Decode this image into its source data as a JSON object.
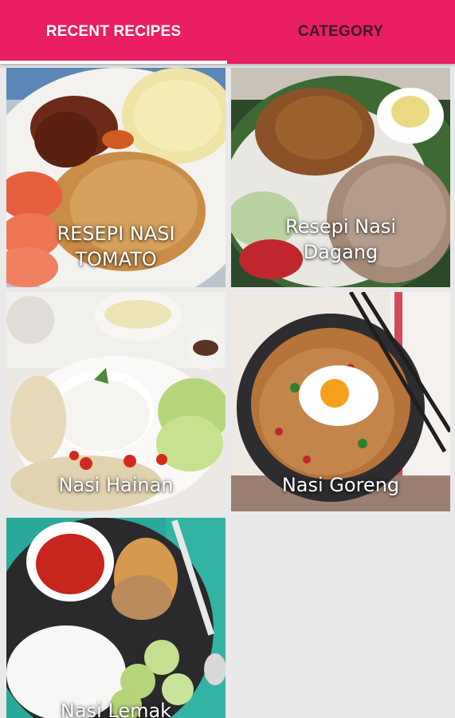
{
  "tabs": {
    "recent": "RECENT RECIPES",
    "category": "CATEGORY"
  },
  "colors": {
    "accent": "#e91e63",
    "active_tab_text": "#ffffff",
    "inactive_tab_text": "#3a1a24",
    "indicator": "#ffffff"
  },
  "recipes": [
    {
      "line1": "RESEPI NASI",
      "line2": "TOMATO"
    },
    {
      "line1": "Resepi Nasi",
      "line2": "Dagang"
    },
    {
      "line1": "Nasi Hainan"
    },
    {
      "line1": "Nasi Goreng"
    },
    {
      "line1": "Nasi Lemak"
    }
  ]
}
